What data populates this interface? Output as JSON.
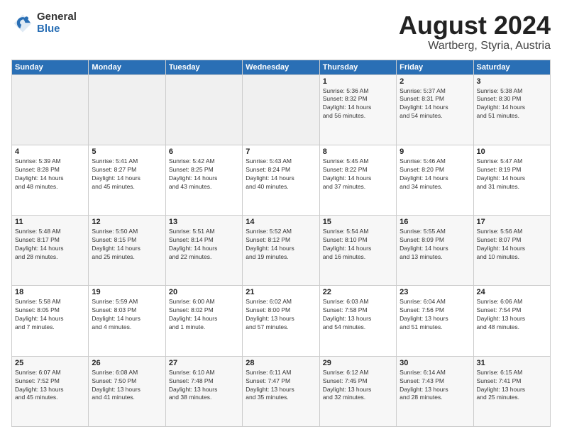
{
  "logo": {
    "general": "General",
    "blue": "Blue"
  },
  "title": {
    "month_year": "August 2024",
    "location": "Wartberg, Styria, Austria"
  },
  "headers": [
    "Sunday",
    "Monday",
    "Tuesday",
    "Wednesday",
    "Thursday",
    "Friday",
    "Saturday"
  ],
  "weeks": [
    [
      {
        "day": "",
        "info": ""
      },
      {
        "day": "",
        "info": ""
      },
      {
        "day": "",
        "info": ""
      },
      {
        "day": "",
        "info": ""
      },
      {
        "day": "1",
        "info": "Sunrise: 5:36 AM\nSunset: 8:32 PM\nDaylight: 14 hours\nand 56 minutes."
      },
      {
        "day": "2",
        "info": "Sunrise: 5:37 AM\nSunset: 8:31 PM\nDaylight: 14 hours\nand 54 minutes."
      },
      {
        "day": "3",
        "info": "Sunrise: 5:38 AM\nSunset: 8:30 PM\nDaylight: 14 hours\nand 51 minutes."
      }
    ],
    [
      {
        "day": "4",
        "info": "Sunrise: 5:39 AM\nSunset: 8:28 PM\nDaylight: 14 hours\nand 48 minutes."
      },
      {
        "day": "5",
        "info": "Sunrise: 5:41 AM\nSunset: 8:27 PM\nDaylight: 14 hours\nand 45 minutes."
      },
      {
        "day": "6",
        "info": "Sunrise: 5:42 AM\nSunset: 8:25 PM\nDaylight: 14 hours\nand 43 minutes."
      },
      {
        "day": "7",
        "info": "Sunrise: 5:43 AM\nSunset: 8:24 PM\nDaylight: 14 hours\nand 40 minutes."
      },
      {
        "day": "8",
        "info": "Sunrise: 5:45 AM\nSunset: 8:22 PM\nDaylight: 14 hours\nand 37 minutes."
      },
      {
        "day": "9",
        "info": "Sunrise: 5:46 AM\nSunset: 8:20 PM\nDaylight: 14 hours\nand 34 minutes."
      },
      {
        "day": "10",
        "info": "Sunrise: 5:47 AM\nSunset: 8:19 PM\nDaylight: 14 hours\nand 31 minutes."
      }
    ],
    [
      {
        "day": "11",
        "info": "Sunrise: 5:48 AM\nSunset: 8:17 PM\nDaylight: 14 hours\nand 28 minutes."
      },
      {
        "day": "12",
        "info": "Sunrise: 5:50 AM\nSunset: 8:15 PM\nDaylight: 14 hours\nand 25 minutes."
      },
      {
        "day": "13",
        "info": "Sunrise: 5:51 AM\nSunset: 8:14 PM\nDaylight: 14 hours\nand 22 minutes."
      },
      {
        "day": "14",
        "info": "Sunrise: 5:52 AM\nSunset: 8:12 PM\nDaylight: 14 hours\nand 19 minutes."
      },
      {
        "day": "15",
        "info": "Sunrise: 5:54 AM\nSunset: 8:10 PM\nDaylight: 14 hours\nand 16 minutes."
      },
      {
        "day": "16",
        "info": "Sunrise: 5:55 AM\nSunset: 8:09 PM\nDaylight: 14 hours\nand 13 minutes."
      },
      {
        "day": "17",
        "info": "Sunrise: 5:56 AM\nSunset: 8:07 PM\nDaylight: 14 hours\nand 10 minutes."
      }
    ],
    [
      {
        "day": "18",
        "info": "Sunrise: 5:58 AM\nSunset: 8:05 PM\nDaylight: 14 hours\nand 7 minutes."
      },
      {
        "day": "19",
        "info": "Sunrise: 5:59 AM\nSunset: 8:03 PM\nDaylight: 14 hours\nand 4 minutes."
      },
      {
        "day": "20",
        "info": "Sunrise: 6:00 AM\nSunset: 8:02 PM\nDaylight: 14 hours\nand 1 minute."
      },
      {
        "day": "21",
        "info": "Sunrise: 6:02 AM\nSunset: 8:00 PM\nDaylight: 13 hours\nand 57 minutes."
      },
      {
        "day": "22",
        "info": "Sunrise: 6:03 AM\nSunset: 7:58 PM\nDaylight: 13 hours\nand 54 minutes."
      },
      {
        "day": "23",
        "info": "Sunrise: 6:04 AM\nSunset: 7:56 PM\nDaylight: 13 hours\nand 51 minutes."
      },
      {
        "day": "24",
        "info": "Sunrise: 6:06 AM\nSunset: 7:54 PM\nDaylight: 13 hours\nand 48 minutes."
      }
    ],
    [
      {
        "day": "25",
        "info": "Sunrise: 6:07 AM\nSunset: 7:52 PM\nDaylight: 13 hours\nand 45 minutes."
      },
      {
        "day": "26",
        "info": "Sunrise: 6:08 AM\nSunset: 7:50 PM\nDaylight: 13 hours\nand 41 minutes."
      },
      {
        "day": "27",
        "info": "Sunrise: 6:10 AM\nSunset: 7:48 PM\nDaylight: 13 hours\nand 38 minutes."
      },
      {
        "day": "28",
        "info": "Sunrise: 6:11 AM\nSunset: 7:47 PM\nDaylight: 13 hours\nand 35 minutes."
      },
      {
        "day": "29",
        "info": "Sunrise: 6:12 AM\nSunset: 7:45 PM\nDaylight: 13 hours\nand 32 minutes."
      },
      {
        "day": "30",
        "info": "Sunrise: 6:14 AM\nSunset: 7:43 PM\nDaylight: 13 hours\nand 28 minutes."
      },
      {
        "day": "31",
        "info": "Sunrise: 6:15 AM\nSunset: 7:41 PM\nDaylight: 13 hours\nand 25 minutes."
      }
    ]
  ]
}
